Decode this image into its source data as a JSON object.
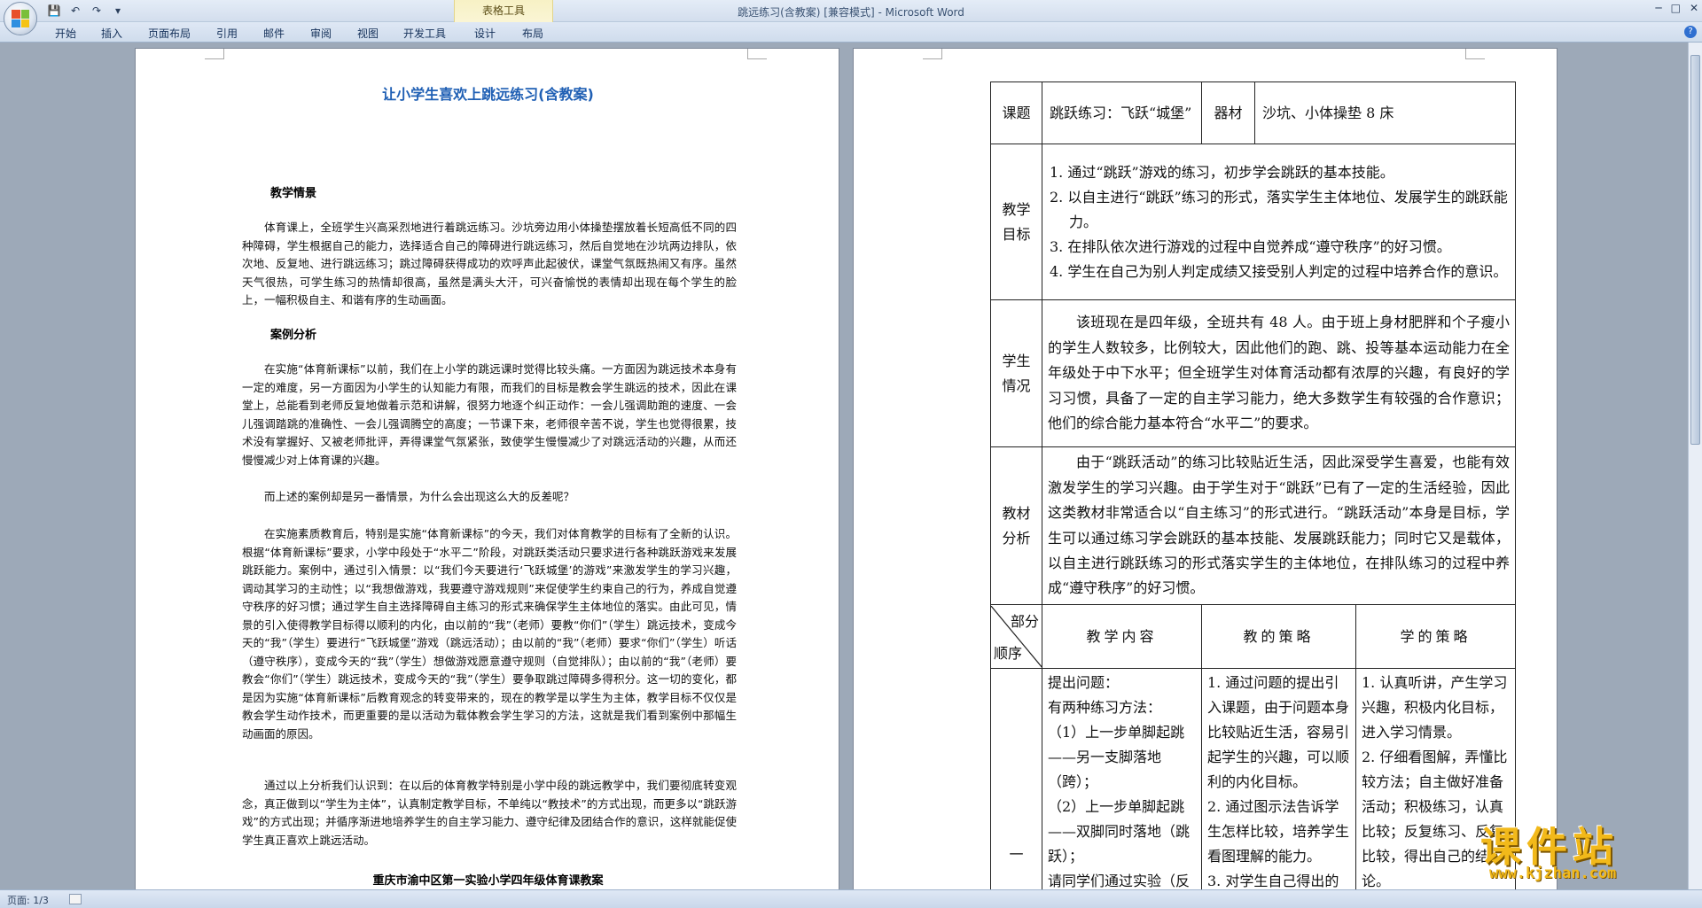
{
  "window": {
    "title": "跳远练习(含教案) [兼容模式]",
    "app": "Microsoft Word",
    "context_tab_group": "表格工具"
  },
  "ribbon_tabs": [
    "开始",
    "插入",
    "页面布局",
    "引用",
    "邮件",
    "审阅",
    "视图",
    "开发工具",
    "设计",
    "布局"
  ],
  "status": {
    "page": "页面: 1/3"
  },
  "doc_left": {
    "title": "让小学生喜欢上跳远练习(含教案)",
    "heading1": "教学情景",
    "para1": "体育课上，全班学生兴高采烈地进行着跳远练习。沙坑旁边用小体操垫摆放着长短高低不同的四种障碍，学生根据自己的能力，选择适合自己的障碍进行跳远练习，然后自觉地在沙坑两边排队，依次地、反复地、进行跳远练习；跳过障碍获得成功的欢呼声此起彼伏，课堂气氛既热闹又有序。虽然天气很热，可学生练习的热情却很高，虽然是满头大汗，可兴奋愉悦的表情却出现在每个学生的脸上，一幅积极自主、和谐有序的生动画面。",
    "heading2": "案例分析",
    "para2": "在实施“体育新课标”以前，我们在上小学的跳远课时觉得比较头痛。一方面因为跳远技术本身有一定的难度，另一方面因为小学生的认知能力有限，而我们的目标是教会学生跳远的技术，因此在课堂上，总能看到老师反复地做着示范和讲解，很努力地逐个纠正动作：一会儿强调助跑的速度、一会儿强调踏跳的准确性、一会儿强调腾空的高度；一节课下来，老师很辛苦不说，学生也觉得很累，技术没有掌握好、又被老师批评，弄得课堂气氛紧张，致使学生慢慢减少了对跳远活动的兴趣，从而还慢慢减少对上体育课的兴趣。",
    "para3": "而上述的案例却是另一番情景，为什么会出现这么大的反差呢？",
    "para4": "在实施素质教育后，特别是实施“体育新课标”的今天，我们对体育教学的目标有了全新的认识。根据“体育新课标”要求，小学中段处于“水平二”阶段，对跳跃类活动只要求进行各种跳跃游戏来发展跳跃能力。案例中，通过引入情景：以“我们今天要进行‘飞跃城堡’的游戏”来激发学生的学习兴趣，调动其学习的主动性；以“我想做游戏，我要遵守游戏规则”来促使学生约束自己的行为，养成自觉遵守秩序的好习惯；通过学生自主选择障碍自主练习的形式来确保学生主体地位的落实。由此可见，情景的引入使得教学目标得以顺利的内化，由以前的“我”（老师）要教“你们”（学生）跳远技术，变成今天的“我”（学生）要进行“飞跃城堡”游戏（跳远活动）；由以前的“我”（老师）要求“你们”（学生）听话（遵守秩序），变成今天的“我”（学生）想做游戏愿意遵守规则（自觉排队）；由以前的“我”（老师）要教会“你们”（学生）跳远技术，变成今天的“我”（学生）要争取跳过障碍多得积分。这一切的变化，都是因为实施“体育新课标”后教育观念的转变带来的，现在的教学是以学生为主体，教学目标不仅仅是教会学生动作技术，而更重要的是以活动为载体教会学生学习的方法，这就是我们看到案例中那幅生动画面的原因。",
    "para5": "通过以上分析我们认识到：在以后的体育教学特别是小学中段的跳远教学中，我们要彻底转变观念，真正做到以“学生为主体”，认真制定教学目标，不单纯以“教技术”的方式出现，而更多以“跳跃游戏”的方式出现；并循序渐进地培养学生的自主学习能力、遵守纪律及团结合作的意识，这样就能促使学生真正喜欢上跳远活动。",
    "footer": "重庆市渝中区第一实验小学四年级体育课教案"
  },
  "doc_right": {
    "row_topic": {
      "label": "课题",
      "value": "跳跃练习：飞跃“城堡”",
      "equip_label": "器材",
      "equip_value": "沙坑、小体操垫 8 床"
    },
    "row_goals": {
      "label": [
        "教学",
        "目标"
      ],
      "items": [
        "1. 通过“跳跃”游戏的练习，初步学会跳跃的基本技能。",
        "2. 以自主进行“跳跃”练习的形式，落实学生主体地位、发展学生的跳跃能力。",
        "3. 在排队依次进行游戏的过程中自觉养成“遵守秩序”的好习惯。",
        "4. 学生在自己为别人判定成绩又接受别人判定的过程中培养合作的意识。"
      ]
    },
    "row_students": {
      "label": [
        "学生",
        "情况"
      ],
      "text": "该班现在是四年级，全班共有 48 人。由于班上身材肥胖和个子瘦小的学生人数较多，比例较大，因此他们的跑、跳、投等基本运动能力在全年级处于中下水平；但全班学生对体育活动都有浓厚的兴趣，有良好的学习习惯，具备了一定的自主学习能力，绝大多数学生有较强的合作意识；他们的综合能力基本符合“水平二”的要求。"
    },
    "row_material": {
      "label": [
        "教材",
        "分析"
      ],
      "text": "由于“跳跃活动”的练习比较贴近生活，因此深受学生喜爱，也能有效激发学生的学习兴趣。由于学生对于“跳跃”已有了一定的生活经验，因此这类教材非常适合以“自主练习”的形式进行。“跳跃活动”本身是目标，学生可以通过练习学会跳跃的基本技能、发展跳跃能力；同时它又是载体，以自主进行跳跃练习的形式落实学生的主体地位，在排队练习的过程中养成“遵守秩序”的好习惯。"
    },
    "header_row": {
      "diag_top": "部分",
      "diag_bottom": "顺序",
      "col1": "教学内容",
      "col2": "教的策略",
      "col3": "学的策略"
    },
    "row_part1": {
      "seq": "一",
      "content": "提出问题：\n有两种练习方法：\n（1）上一步单脚起跳——另一支脚落地（跨）；\n（2）上一步单脚起跳——双脚同时落地（跳跃）；\n请同学们通过实验（反",
      "teach": "1. 通过问题的提出引入课题，由于问题本身比较贴近生活，容易引起学生的兴趣，可以顺利的内化目标。\n2. 通过图示法告诉学生怎样比较，培养学生看图理解的能力。\n3. 对学生自己得出的",
      "learn": "1. 认真听讲，产生学习兴趣，积极内化目标，进入学习情景。\n2. 仔细看图解，弄懂比较方法；自主做好准备活动；积极练习，认真比较；反复练习、反复比较，得出自己的结论。"
    }
  },
  "watermark": {
    "text": "课件站",
    "url": "www.kjzhan.com"
  }
}
